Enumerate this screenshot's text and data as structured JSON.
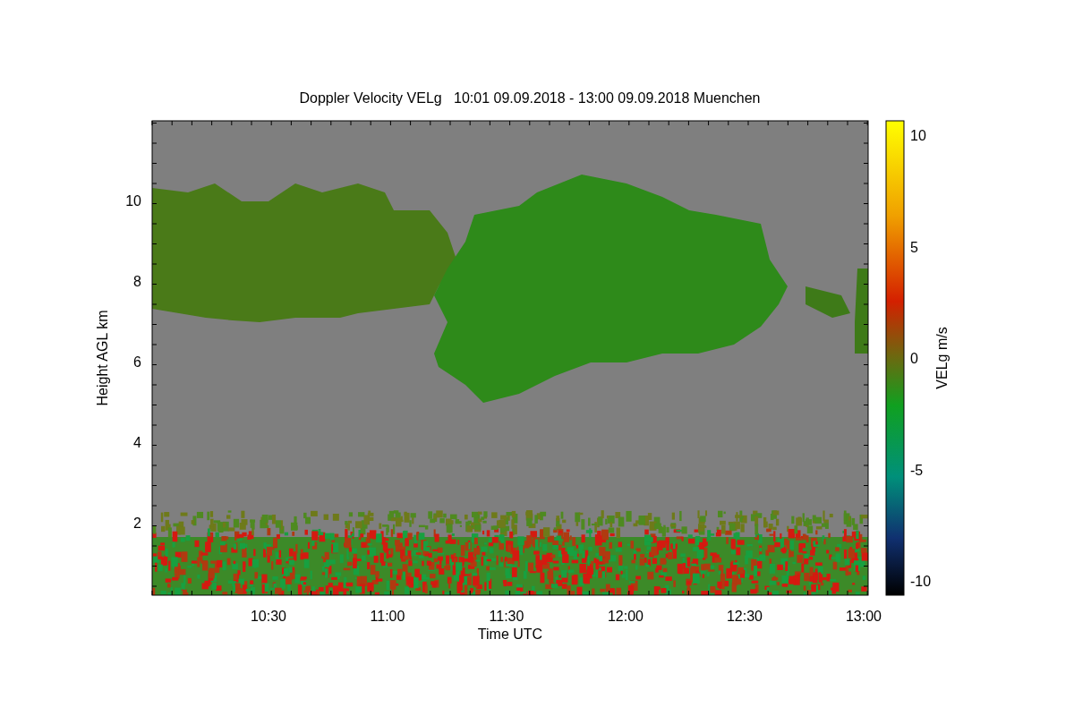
{
  "title": "Doppler Velocity VELg   10:01 09.09.2018 - 13:00 09.09.2018 Muenchen",
  "y_axis": {
    "label": "Height AGL km",
    "ticks": [
      "10",
      "8",
      "6",
      "4",
      "2"
    ]
  },
  "x_axis": {
    "label": "Time UTC",
    "ticks": [
      "10:30",
      "11:00",
      "11:30",
      "12:00",
      "12:30",
      "13:00"
    ]
  },
  "colorbar": {
    "label": "VELg m/s",
    "ticks": [
      "10",
      "5",
      "0",
      "-5",
      "-10"
    ]
  }
}
